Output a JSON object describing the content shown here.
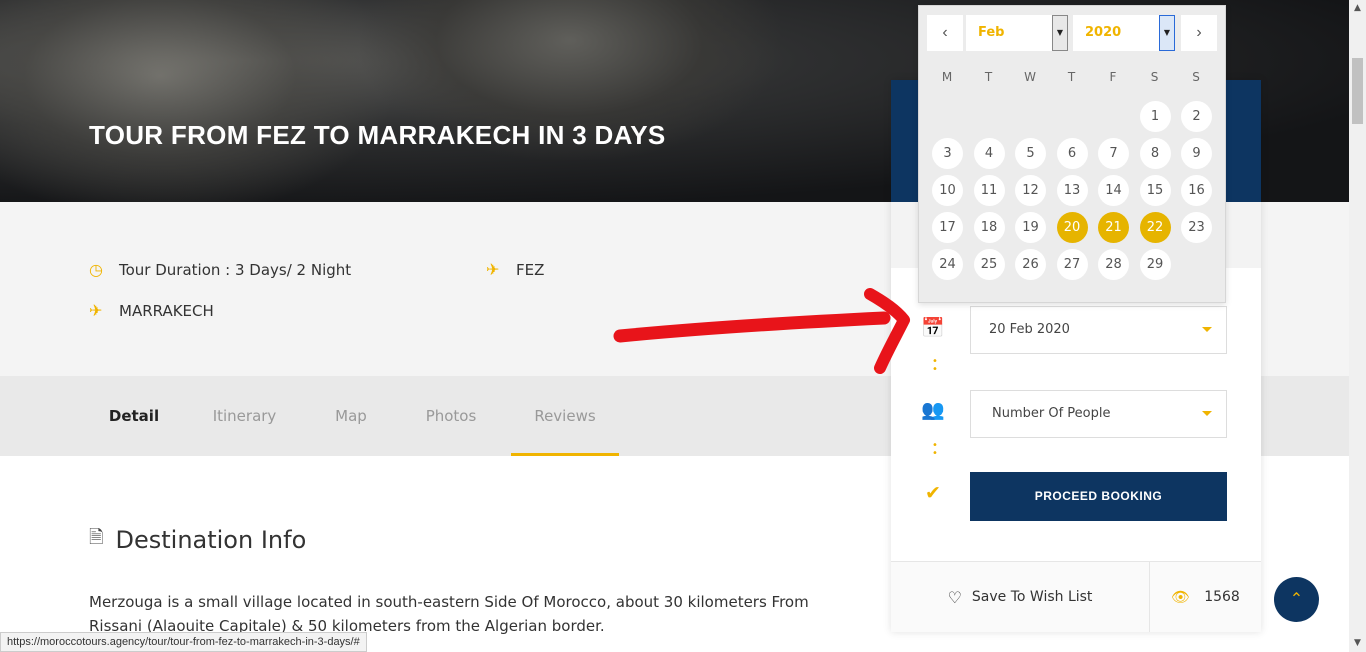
{
  "hero": {
    "title": "TOUR FROM FEZ TO MARRAKECH IN 3 DAYS"
  },
  "info": {
    "duration": "Tour Duration : 3 Days/ 2 Night",
    "departure": "FEZ",
    "arrival": "MARRAKECH"
  },
  "tabs": [
    {
      "label": "Detail"
    },
    {
      "label": "Itinerary"
    },
    {
      "label": "Map"
    },
    {
      "label": "Photos"
    },
    {
      "label": "Reviews"
    }
  ],
  "destination": {
    "title": "Destination Info",
    "description": "Merzouga is a small village located in south-eastern Side Of Morocco, about 30 kilometers From Rissani (Alaouite Capitale) & 50 kilometers from the Algerian border."
  },
  "booking": {
    "date_value": "20 Feb 2020",
    "people_placeholder": "Number Of People",
    "proceed_label": "PROCEED BOOKING",
    "wishlist_label": "Save To Wish List",
    "views_count": "1568"
  },
  "calendar": {
    "month": "Feb",
    "year": "2020",
    "weekdays": [
      "M",
      "T",
      "W",
      "T",
      "F",
      "S",
      "S"
    ],
    "days": [
      "1",
      "2",
      "3",
      "4",
      "5",
      "6",
      "7",
      "8",
      "9",
      "10",
      "11",
      "12",
      "13",
      "14",
      "15",
      "16",
      "17",
      "18",
      "19",
      "20",
      "21",
      "22",
      "23",
      "24",
      "25",
      "26",
      "27",
      "28",
      "29"
    ],
    "selected_days": [
      "20",
      "21",
      "22"
    ]
  },
  "status_bar": {
    "url": "https://moroccotours.agency/tour/tour-from-fez-to-marrakech-in-3-days/#"
  },
  "colors": {
    "accent": "#f0b400",
    "navy": "#0d3561",
    "annotation_red": "#e8141a"
  }
}
